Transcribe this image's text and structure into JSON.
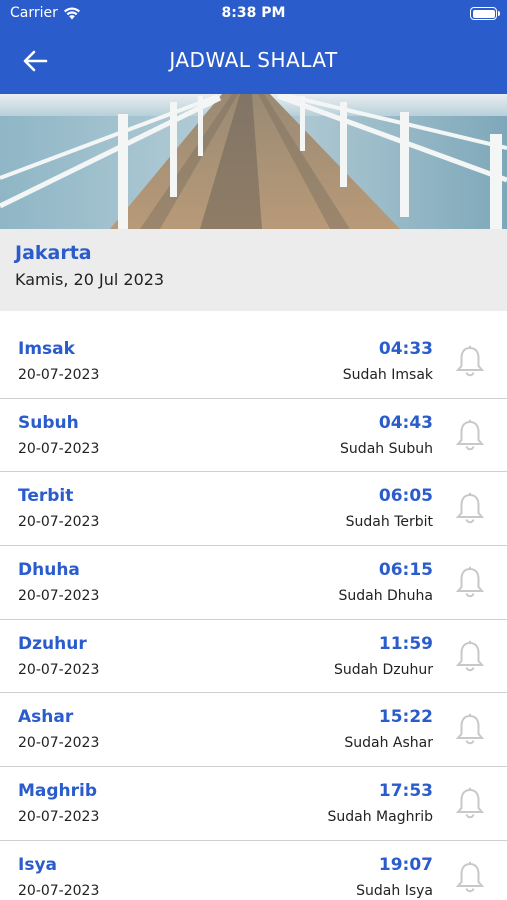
{
  "status_bar": {
    "carrier": "Carrier",
    "time": "8:38 PM"
  },
  "header": {
    "title": "JADWAL SHALAT",
    "back_icon": "arrow-left-icon"
  },
  "location": {
    "city": "Jakarta",
    "date": "Kamis, 20 Jul 2023"
  },
  "colors": {
    "primary": "#2b5ccc",
    "location_bg": "#ececec",
    "divider": "#cfcfcf",
    "bell": "#c8c8c8"
  },
  "prayers": [
    {
      "name": "Imsak",
      "date": "20-07-2023",
      "time": "04:33",
      "status": "Sudah Imsak",
      "icon": "bell-icon"
    },
    {
      "name": "Subuh",
      "date": "20-07-2023",
      "time": "04:43",
      "status": "Sudah Subuh",
      "icon": "bell-icon"
    },
    {
      "name": "Terbit",
      "date": "20-07-2023",
      "time": "06:05",
      "status": "Sudah Terbit",
      "icon": "bell-icon"
    },
    {
      "name": "Dhuha",
      "date": "20-07-2023",
      "time": "06:15",
      "status": "Sudah Dhuha",
      "icon": "bell-icon"
    },
    {
      "name": "Dzuhur",
      "date": "20-07-2023",
      "time": "11:59",
      "status": "Sudah Dzuhur",
      "icon": "bell-icon"
    },
    {
      "name": "Ashar",
      "date": "20-07-2023",
      "time": "15:22",
      "status": "Sudah Ashar",
      "icon": "bell-icon"
    },
    {
      "name": "Maghrib",
      "date": "20-07-2023",
      "time": "17:53",
      "status": "Sudah Maghrib",
      "icon": "bell-icon"
    },
    {
      "name": "Isya",
      "date": "20-07-2023",
      "time": "19:07",
      "status": "Sudah Isya",
      "icon": "bell-icon"
    }
  ]
}
